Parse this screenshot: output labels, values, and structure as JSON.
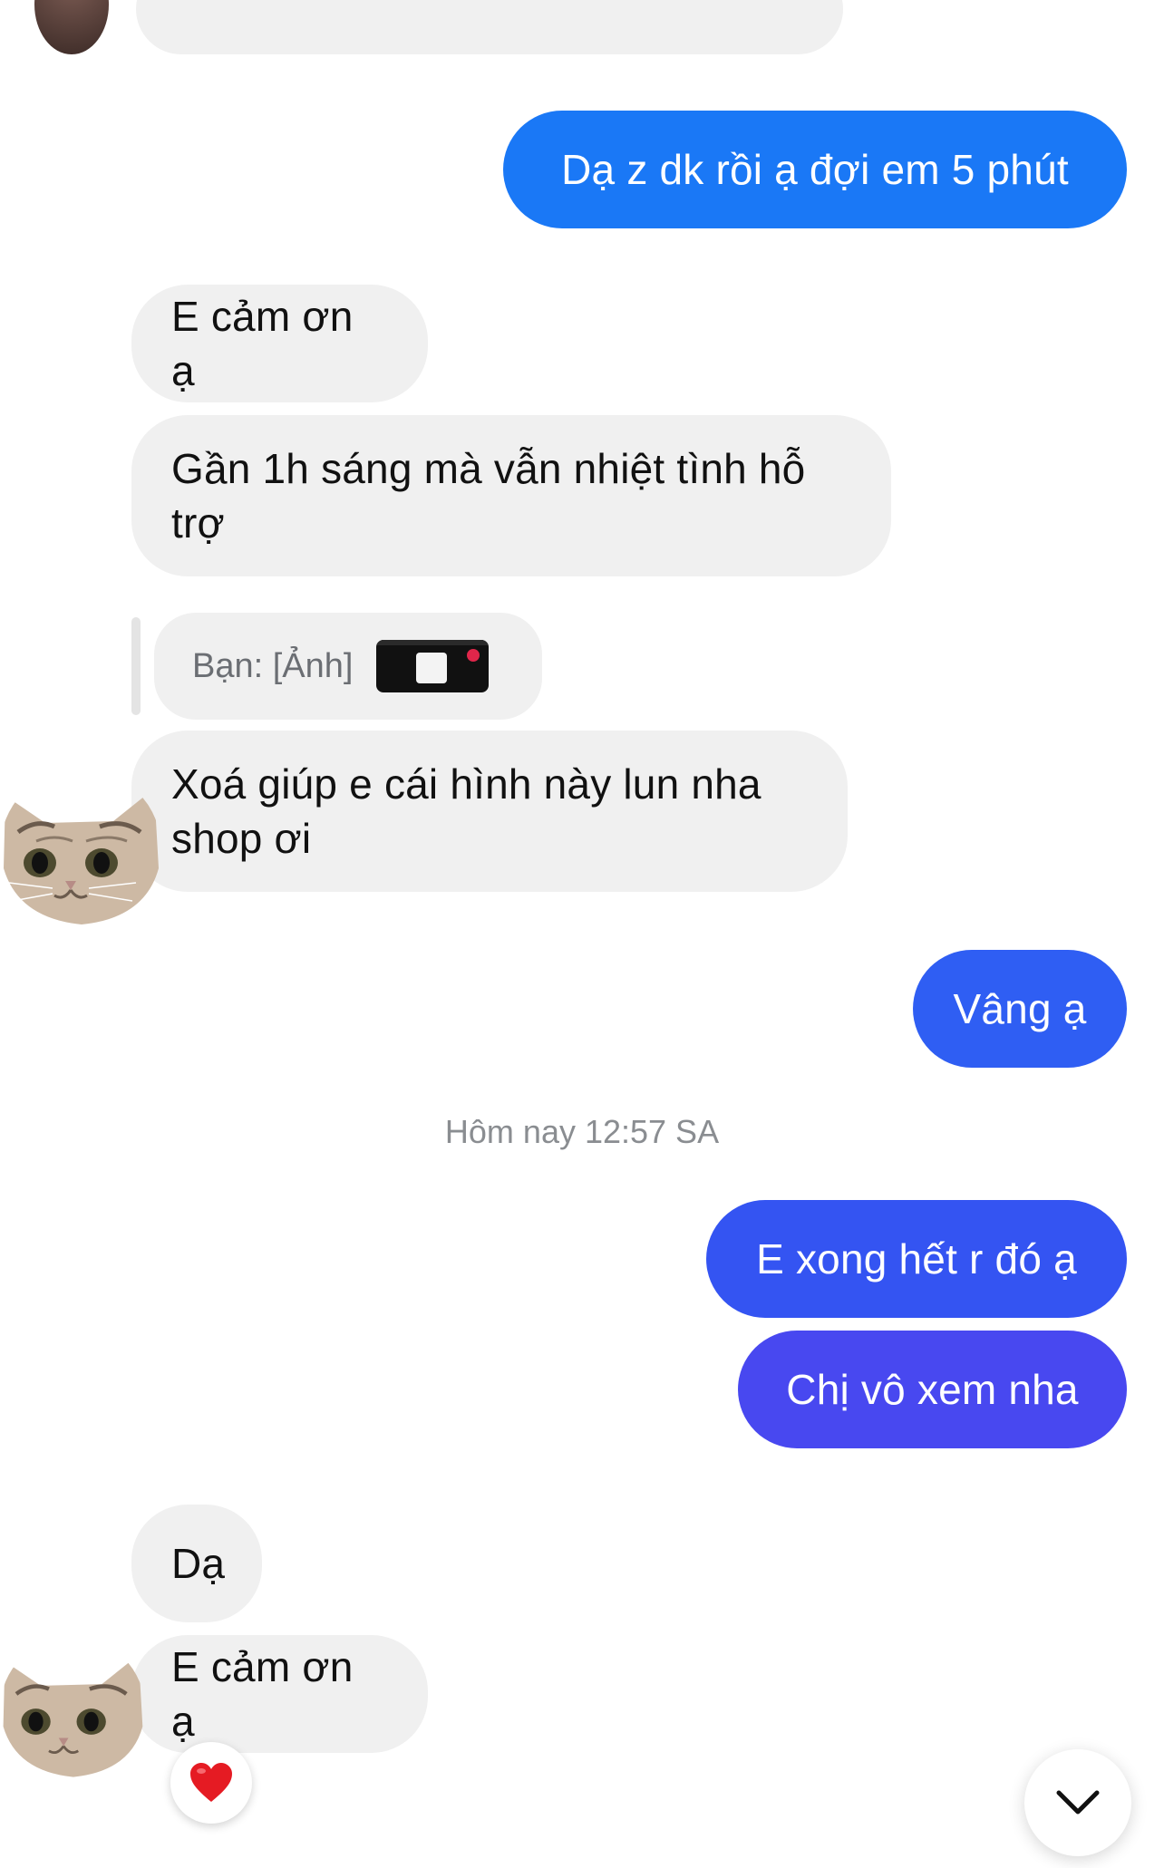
{
  "messages": [
    {
      "id": "m1",
      "from": "me",
      "text": "Dạ z dk rồi ạ đợi em 5 phút"
    },
    {
      "id": "m2",
      "from": "them",
      "text": "E cảm ơn ạ"
    },
    {
      "id": "m3",
      "from": "them",
      "text": "Gần 1h sáng mà vẫn nhiệt tình hỗ trợ"
    },
    {
      "id": "m4",
      "from": "them",
      "reply_to": "Bạn: [Ảnh]",
      "text": "Xoá giúp e cái hình này lun nha shop ơi"
    },
    {
      "id": "m5",
      "from": "me",
      "text": "Vâng ạ"
    },
    {
      "id": "m6",
      "from": "me",
      "text": "E xong hết r đó ạ"
    },
    {
      "id": "m7",
      "from": "me",
      "text": "Chị vô xem nha"
    },
    {
      "id": "m8",
      "from": "them",
      "text": "Dạ"
    },
    {
      "id": "m9",
      "from": "them",
      "text": "E cảm ơn ạ",
      "reaction": "heart-icon"
    }
  ],
  "timestamp": "Hôm nay 12:57 SA",
  "colors": {
    "outgoing_top": "#1a7cf5",
    "outgoing_bottom": "#4a46f0",
    "incoming": "#f0f0f0",
    "timestamp": "#8a8d91"
  },
  "icons": {
    "reaction": "heart-icon",
    "scroll": "chevron-down-icon",
    "avatar": "cat-avatar-icon"
  }
}
